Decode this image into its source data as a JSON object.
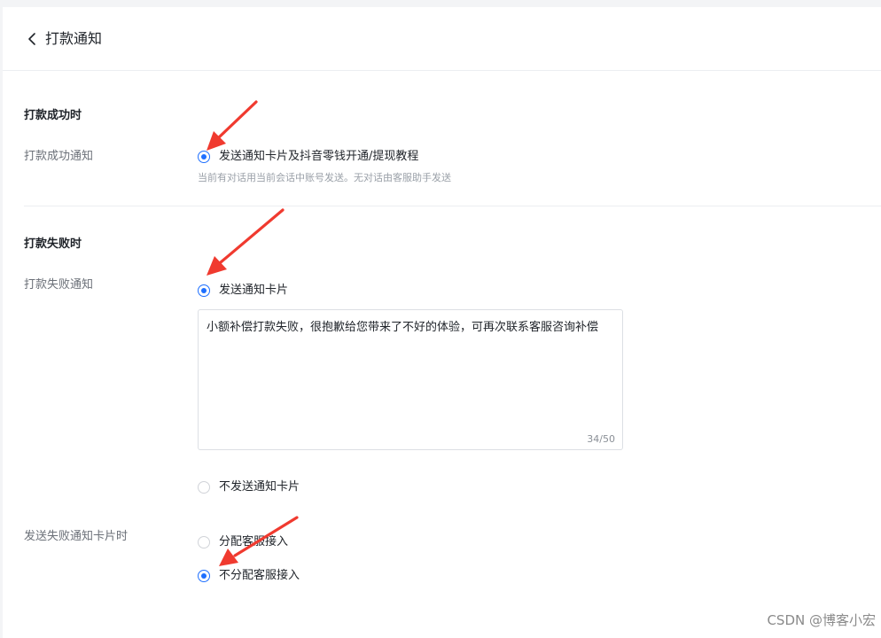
{
  "header": {
    "title": "打款通知"
  },
  "success_section": {
    "title": "打款成功时",
    "field_label": "打款成功通知",
    "option_label": "发送通知卡片及抖音零钱开通/提现教程",
    "option_checked": true,
    "hint": "当前有对话用当前会话中账号发送。无对话由客服助手发送"
  },
  "failure_section": {
    "title": "打款失败时",
    "field_label": "打款失败通知",
    "send_card_label": "发送通知卡片",
    "send_card_checked": true,
    "message_text": "小额补偿打款失败，很抱歉给您带来了不好的体验，可再次联系客服咨询补偿",
    "char_count": "34/50",
    "no_card_label": "不发送通知卡片",
    "no_card_checked": false
  },
  "fallback_section": {
    "field_label": "发送失败通知卡片时",
    "assign_label": "分配客服接入",
    "assign_checked": false,
    "no_assign_label": "不分配客服接入",
    "no_assign_checked": true
  },
  "annotations": {
    "arrow_color": "#f03a2f"
  },
  "colors": {
    "accent": "#1e6fff"
  },
  "watermark": "CSDN @博客小宏"
}
